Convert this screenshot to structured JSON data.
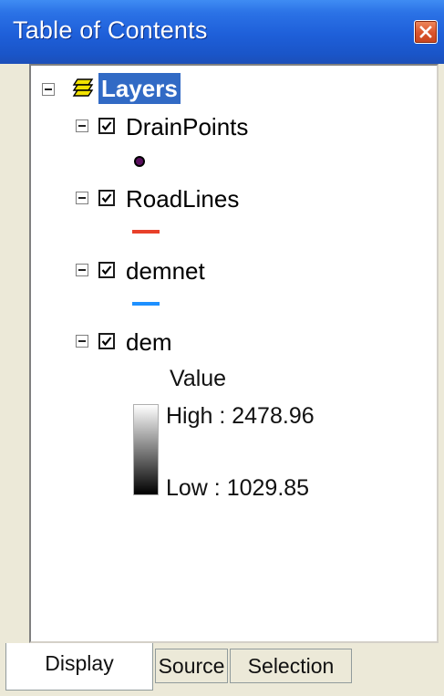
{
  "window": {
    "title": "Table of Contents"
  },
  "toc": {
    "root_label": "Layers",
    "layers": [
      {
        "name": "DrainPoints",
        "checked": true,
        "symbol": "point-marker",
        "symbol_color": "#5a0f5e"
      },
      {
        "name": "RoadLines",
        "checked": true,
        "symbol": "line",
        "symbol_color": "#e8402a"
      },
      {
        "name": "demnet",
        "checked": true,
        "symbol": "line",
        "symbol_color": "#1e90ff"
      },
      {
        "name": "dem",
        "checked": true,
        "symbol": "color-ramp"
      }
    ],
    "dem_legend": {
      "heading": "Value",
      "high_label": "High : 2478.96",
      "low_label": "Low : 1029.85"
    }
  },
  "tabs": [
    {
      "label": "Display",
      "active": true
    },
    {
      "label": "Source",
      "active": false
    },
    {
      "label": "Selection",
      "active": false
    }
  ],
  "colors": {
    "title_bar": "#1e5fd9",
    "selection_highlight": "#316ac5",
    "close_button": "#d9532a"
  }
}
